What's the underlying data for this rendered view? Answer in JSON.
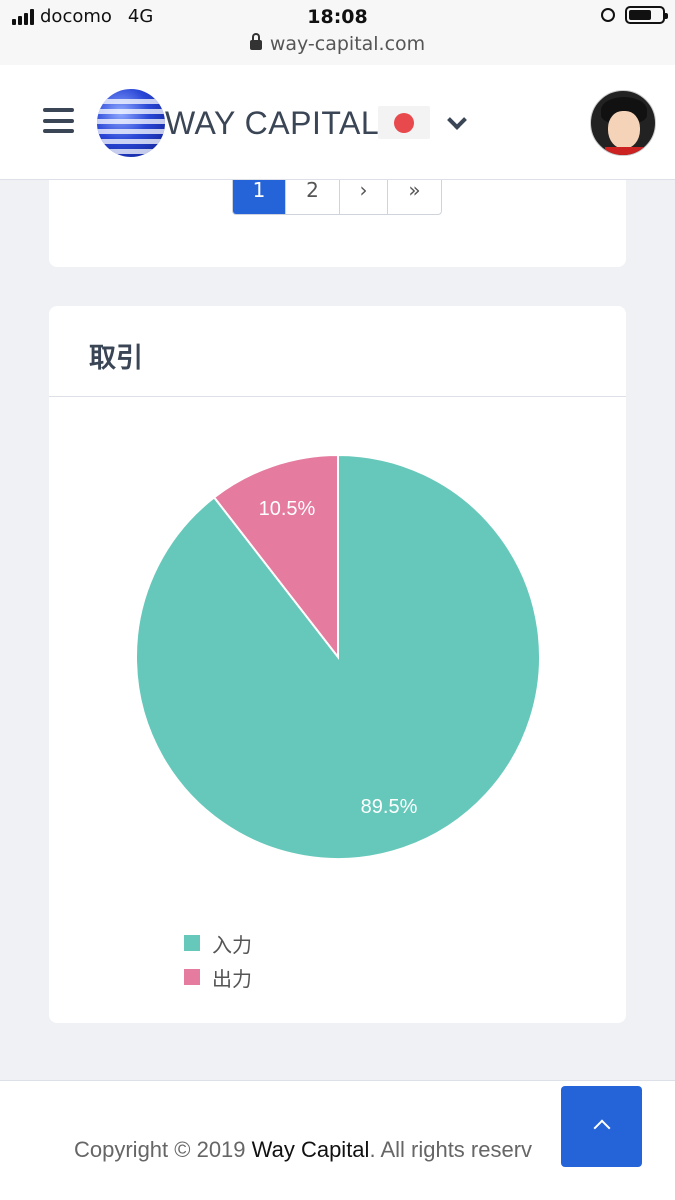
{
  "status_bar": {
    "carrier": "docomo",
    "network": "4G",
    "time": "18:08"
  },
  "url_bar": {
    "url": "way-capital.com"
  },
  "header": {
    "brand": "WAY CAPITAL",
    "language_flag": "japan-flag",
    "menu_icon": "hamburger-icon",
    "dropdown_icon": "chevron-down-icon",
    "avatar": "user-avatar"
  },
  "pagination": {
    "pages": [
      "1",
      "2"
    ],
    "next": "›",
    "last": "»",
    "active_page": "1"
  },
  "transactions_card": {
    "title": "取引"
  },
  "chart_data": {
    "type": "pie",
    "categories": [
      "入力",
      "出力"
    ],
    "values": [
      89.5,
      10.5
    ],
    "labels": [
      "89.5%",
      "10.5%"
    ],
    "colors": [
      "#66c8ba",
      "#e57b9f"
    ],
    "legend_position": "bottom-left"
  },
  "footer": {
    "copyright_prefix": "Copyright © 2019 ",
    "company": "Way Capital",
    "copyright_suffix": ". All rights reserv"
  },
  "back_to_top_icon": "chevron-up-icon",
  "colors": {
    "primary": "#2563d9",
    "text": "#3a4555",
    "background": "#eff1f5"
  }
}
